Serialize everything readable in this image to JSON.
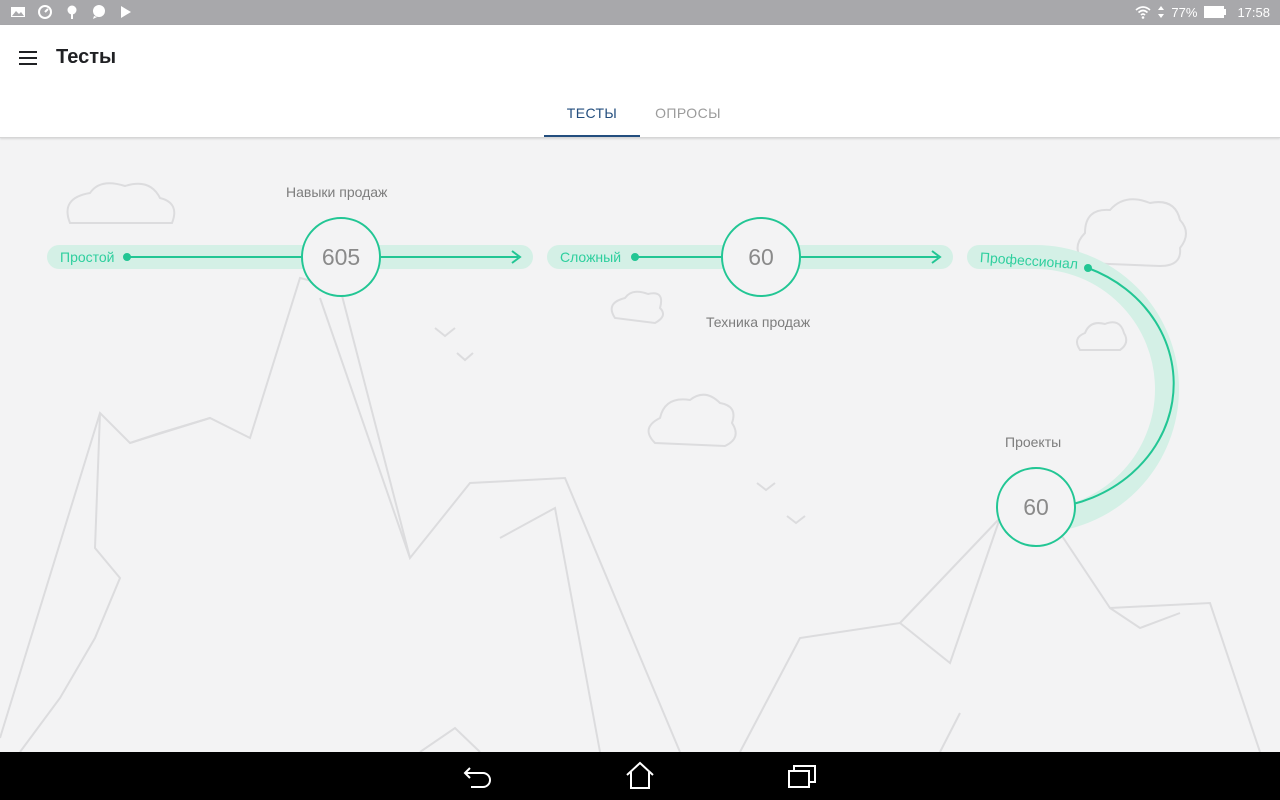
{
  "statusbar": {
    "battery": "77%",
    "time": "17:58"
  },
  "app": {
    "title": "Тесты"
  },
  "tabs": [
    {
      "label": "ТЕСТЫ",
      "active": true
    },
    {
      "label": "ОПРОСЫ",
      "active": false
    }
  ],
  "levels": [
    {
      "label": "Простой"
    },
    {
      "label": "Сложный"
    },
    {
      "label": "Профессионал"
    }
  ],
  "categories": [
    {
      "title": "Навыки продаж",
      "value": "605"
    },
    {
      "title": "Техника продаж",
      "value": "60"
    },
    {
      "title": "Проекты",
      "value": "60"
    }
  ],
  "colors": {
    "accent": "#22c694",
    "track": "#d4f0e6",
    "tab_active": "#234e7e",
    "status_bar": "#a8a8ab"
  }
}
